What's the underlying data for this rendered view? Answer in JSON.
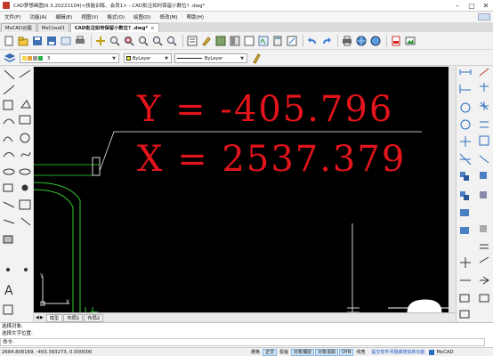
{
  "window": {
    "title": "CAD梦想画图(6.3.20221104)<技能训练、会员1> - CAD批注如何保留小数位? .dwg*",
    "buttons": {
      "minimize": "–",
      "maximize": "▢",
      "close": "✕"
    }
  },
  "menu": {
    "items": [
      "文件(F)",
      "功能(A)",
      "编辑(E)",
      "视图(V)",
      "格式(O)",
      "绘图(D)",
      "修改(M)",
      "帮助(H)"
    ]
  },
  "doc_tabs": [
    {
      "label": "MxCAD云图",
      "active": false
    },
    {
      "label": "MxCloud1",
      "active": false
    },
    {
      "label": "CAD批注如何保留小数位? .dwg*",
      "active": true
    }
  ],
  "doc_tab_close": "×",
  "properties_bar": {
    "layer": "3",
    "color": "ByLayer",
    "linetype": "ByLayer",
    "color_swatch": "#e8e81a"
  },
  "canvas": {
    "text_y": "Y = -405.796",
    "text_x": "X = 2537.379",
    "text_color": "#e3141b",
    "ucs_y": "Y",
    "ucs_x": "X"
  },
  "model_tabs": [
    {
      "label": "模型",
      "active": true
    },
    {
      "label": "布局1",
      "active": false
    },
    {
      "label": "布局2",
      "active": false
    }
  ],
  "command": {
    "history": [
      "选择对象:",
      "选择文字位置:"
    ],
    "prompt": "命令:"
  },
  "statusbar": {
    "coords": "2684.808169,  -493.393273,  0.000000",
    "toggles": [
      {
        "label": "栅格",
        "on": false
      },
      {
        "label": "正交",
        "on": true
      },
      {
        "label": "极轴",
        "on": false
      },
      {
        "label": "对象捕捉",
        "on": true
      },
      {
        "label": "对象追踪",
        "on": true
      },
      {
        "label": "DYN",
        "on": true
      },
      {
        "label": "线宽",
        "on": false
      }
    ],
    "link": "提交软件问题或增加新功能",
    "brand": "MxCAD"
  }
}
